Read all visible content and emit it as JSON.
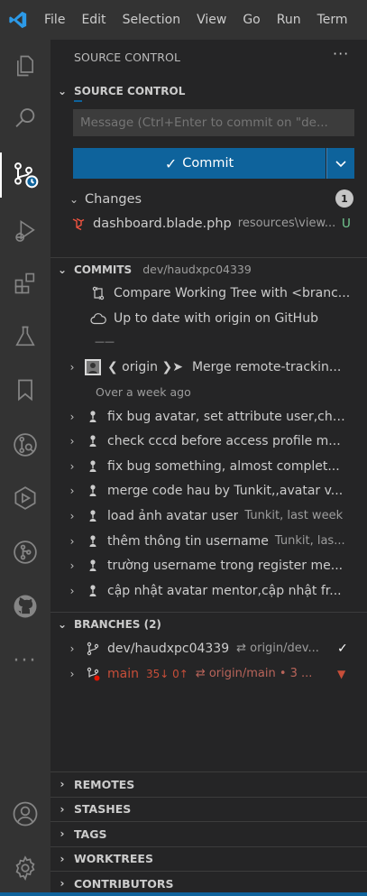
{
  "menu": [
    "File",
    "Edit",
    "Selection",
    "View",
    "Go",
    "Run",
    "Term"
  ],
  "activity": [
    "explorer-icon",
    "search-icon",
    "source-control-icon",
    "run-debug-icon",
    "extensions-icon",
    "testing-icon",
    "bookmarks-icon",
    "gitlens-icon",
    "remote-explorer-icon",
    "git-graph-icon",
    "github-icon",
    "more-icon",
    "account-icon",
    "settings-gear-icon"
  ],
  "sidebar": {
    "title": "SOURCE CONTROL",
    "more": "···"
  },
  "source_control": {
    "header": "SOURCE CONTROL",
    "message_placeholder": "Message (Ctrl+Enter to commit on \"de...",
    "commit_label": "Commit",
    "changes_label": "Changes",
    "changes_count": "1",
    "file_name": "dashboard.blade.php",
    "file_path": "resources\\view...",
    "file_status": "U"
  },
  "commits": {
    "header": "COMMITS",
    "branch": "dev/haudxpc04339",
    "compare": "Compare Working Tree with <branc...",
    "uptodate": "Up to date with origin on GitHub",
    "separator": "——",
    "merge_author": "❮ origin ❯➤",
    "merge_msg": "Merge remote-trackin...",
    "over_week": "Over a week ago",
    "items": [
      {
        "msg": "fix bug avatar, set attribute user,cha...",
        "meta": ""
      },
      {
        "msg": "check cccd before access profile m...",
        "meta": ""
      },
      {
        "msg": "fix bug something, almost complet...",
        "meta": ""
      },
      {
        "msg": "merge code hau by Tunkit,,avatar v...",
        "meta": ""
      },
      {
        "msg": "load ảnh avatar user",
        "meta": "Tunkit, last week"
      },
      {
        "msg": "thêm thông tin username",
        "meta": "Tunkit, las..."
      },
      {
        "msg": "trường username trong register me...",
        "meta": ""
      },
      {
        "msg": "cập nhật avatar mentor,cập nhật fr...",
        "meta": ""
      }
    ]
  },
  "branches": {
    "header": "BRANCHES (2)",
    "items": [
      {
        "name": "dev/haudxpc04339",
        "sync": "⇄ origin/dev...",
        "status": "✓"
      },
      {
        "name": "main",
        "counts": "35↓ 0↑",
        "sync": "⇄ origin/main • 3 ...",
        "status": "▼"
      }
    ]
  },
  "sections": [
    "REMOTES",
    "STASHES",
    "TAGS",
    "WORKTREES",
    "CONTRIBUTORS"
  ],
  "colors": {
    "accent": "#0e639c",
    "untracked": "#73c991",
    "main_branch": "#c74e39",
    "laravel": "#f05340"
  }
}
